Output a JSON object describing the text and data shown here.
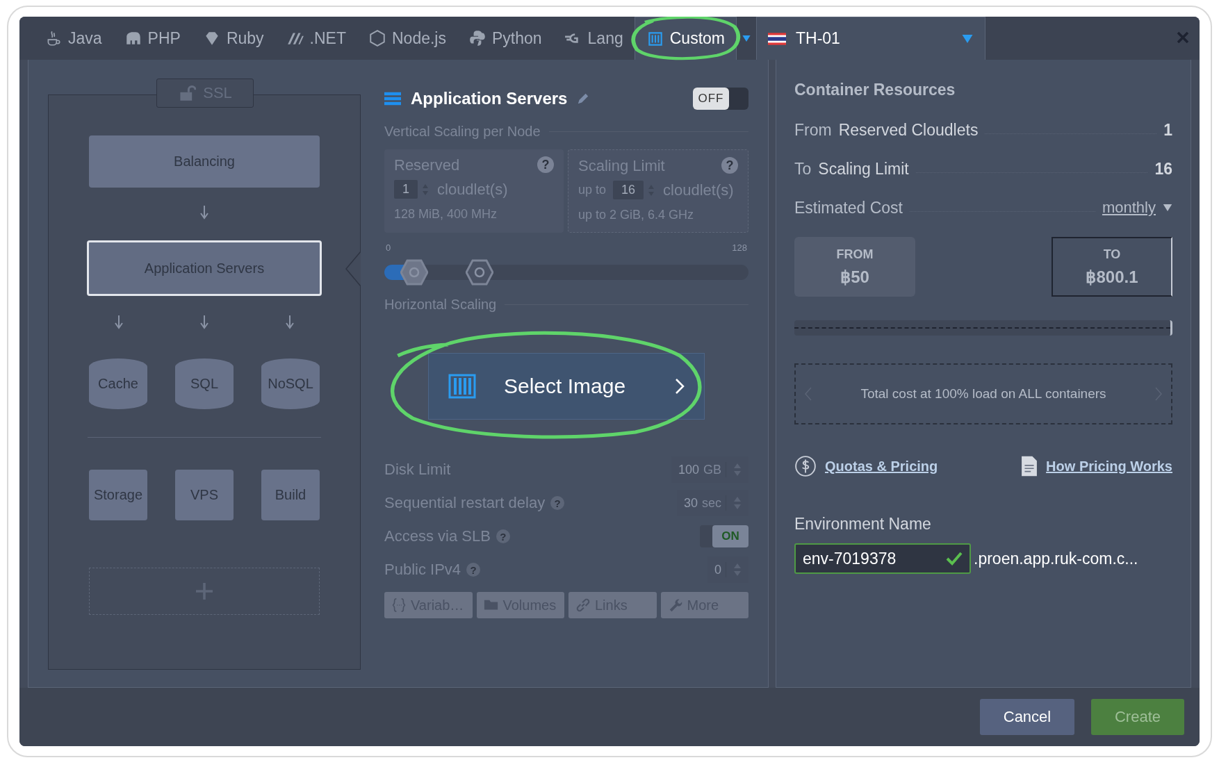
{
  "tabs": [
    {
      "label": "Java",
      "selected": false
    },
    {
      "label": "PHP",
      "selected": false
    },
    {
      "label": "Ruby",
      "selected": false
    },
    {
      "label": ".NET",
      "selected": false
    },
    {
      "label": "Node.js",
      "selected": false
    },
    {
      "label": "Python",
      "selected": false
    },
    {
      "label": "Lang",
      "selected": false
    },
    {
      "label": "Custom",
      "selected": true
    }
  ],
  "region": {
    "label": "TH-01"
  },
  "topology": {
    "ssl": "SSL",
    "balancing": "Balancing",
    "app_servers": {
      "label": "Application Servers",
      "selected": true
    },
    "databases": [
      "Cache",
      "SQL",
      "NoSQL"
    ],
    "extras": [
      "Storage",
      "VPS",
      "Build"
    ]
  },
  "node": {
    "title": "Application Servers",
    "toggle": {
      "label": "OFF",
      "on": false
    }
  },
  "vertical_scaling": {
    "heading": "Vertical Scaling per Node",
    "reserved": {
      "title": "Reserved",
      "help": "?",
      "value": "1",
      "unit": "cloudlet(s)",
      "spec": "128 MiB, 400 MHz"
    },
    "scaling_limit": {
      "title": "Scaling Limit",
      "help": "?",
      "prefix": "up to",
      "value": "16",
      "unit": "cloudlet(s)",
      "spec": "up to 2 GiB, 6.4 GHz"
    },
    "slider": {
      "min_label": "0",
      "max_label": "128",
      "thumbs": [
        {
          "level": 0.08
        },
        {
          "level": 0.26
        }
      ]
    }
  },
  "horizontal_scaling": {
    "heading": "Horizontal Scaling",
    "select_image": "Select Image"
  },
  "settings": [
    {
      "kind": "spinner",
      "label": "Disk Limit",
      "value": "100",
      "unit": "GB"
    },
    {
      "kind": "spinner",
      "label": "Sequential restart delay",
      "help": "?",
      "value": "30",
      "unit": "sec"
    },
    {
      "kind": "toggle",
      "label": "Access via SLB",
      "help": "?",
      "value": "ON",
      "on": true
    },
    {
      "kind": "spinner",
      "label": "Public IPv4",
      "help": "?",
      "value": "0"
    }
  ],
  "actions": [
    "Variab…",
    "Volumes",
    "Links",
    "More"
  ],
  "resources": {
    "title": "Container Resources",
    "rows": [
      {
        "prefix": "From",
        "label": "Reserved Cloudlets",
        "value": "1"
      },
      {
        "prefix": "To",
        "label": "Scaling Limit",
        "value": "16"
      }
    ],
    "estimated": {
      "label": "Estimated Cost",
      "period": "monthly"
    },
    "from": {
      "label": "FROM",
      "value": "฿50"
    },
    "to": {
      "label": "TO",
      "value": "฿800.1"
    },
    "note": "Total cost at 100% load on ALL containers",
    "links": [
      "Quotas & Pricing",
      "How Pricing Works"
    ]
  },
  "environment": {
    "label": "Environment Name",
    "value": "env-7019378",
    "valid": true,
    "domain": ".proen.app.ruk-com.c..."
  },
  "footer": {
    "cancel": "Cancel",
    "create": "Create"
  }
}
